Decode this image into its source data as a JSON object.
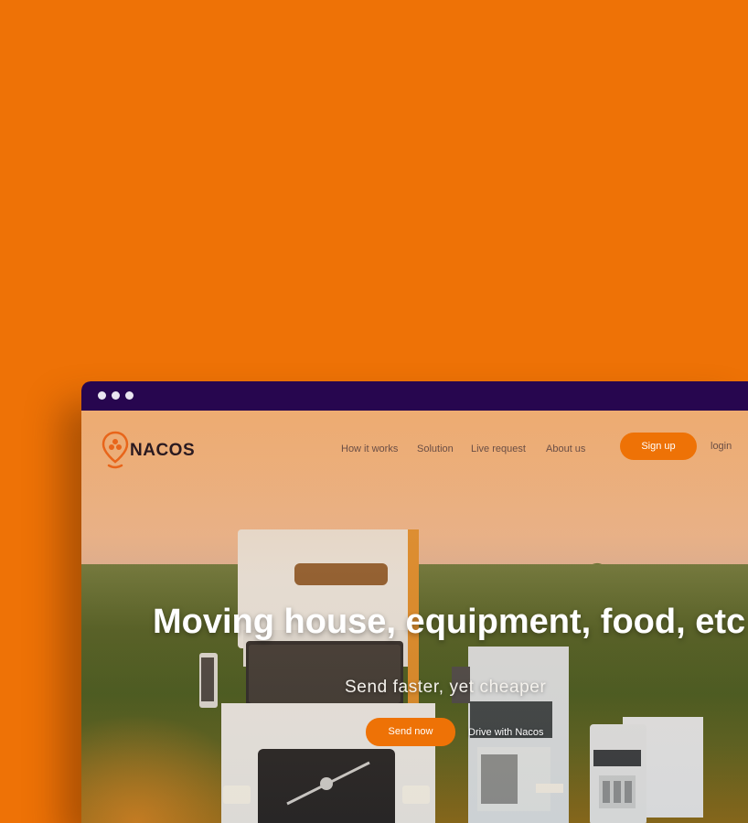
{
  "brand": {
    "name": "NACOS",
    "logo_icon": "location-pin-icon",
    "accent": "#ee7206"
  },
  "colors": {
    "background": "#ee7206",
    "titlebar": "#27064f"
  },
  "nav": {
    "items": [
      "How it works",
      "Solution",
      "Live request",
      "About us"
    ],
    "signup_label": "Sign up",
    "login_label": "login"
  },
  "hero": {
    "title": "Moving house, equipment, food, etc",
    "subtitle": "Send faster, yet cheaper",
    "primary_cta": "Send now",
    "secondary_cta": "Drive with Nacos"
  }
}
